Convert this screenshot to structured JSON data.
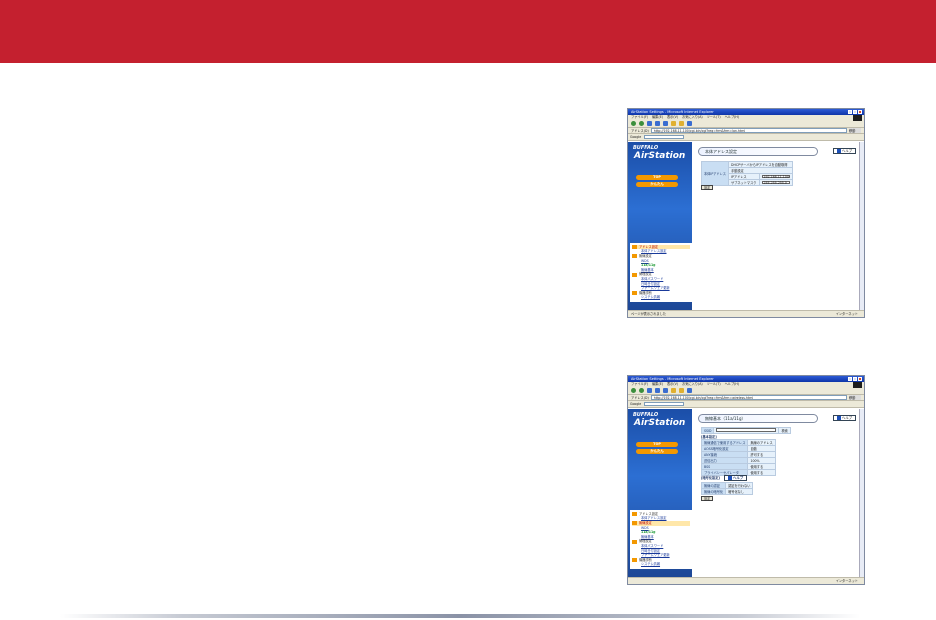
{
  "theme": {
    "banner_color": "#c4202f",
    "accent_orange": "#f39800",
    "sidebar_blue": "#1b4ea8"
  },
  "shot1": {
    "window_title": "AirStation Settings - Microsoft Internet Explorer",
    "menu": [
      "ファイル(F)",
      "編集(E)",
      "表示(V)",
      "お気に入り(A)",
      "ツール(T)",
      "ヘルプ(H)"
    ],
    "address_label": "アドレス(D)",
    "address": "http://192.168.11.100/cgi-bin/cgi?req=frm&frm=lan.html",
    "go_label": "移動",
    "google_label": "Google",
    "brand": "BUFFALO",
    "product": "AirStation",
    "nav_top": "TOP",
    "nav_advanced": "かんたん",
    "menu_items": [
      "アドレス設定",
      "本体アドレス設定",
      "無線設定",
      "WDS",
      "11a/11g",
      "無線基本",
      "管理設定",
      "本体パスワード",
      "日時日付設定",
      "ファームウェア更新",
      "機器診断",
      "システム情報"
    ],
    "page_title": "本体アドレス設定",
    "help": "ヘルプ",
    "field_label": "本体IPアドレス",
    "option1": "DHCPサーバからIPアドレスを自動取得",
    "option2": "手動設定",
    "ip_label": "IPアドレス",
    "ip_value": "192.168.11.100",
    "mask_label": "サブネットマスク",
    "mask_value": "255.255.255.0",
    "submit": "設定",
    "status_left": "ページが表示されました",
    "status_right": "インターネット"
  },
  "shot2": {
    "window_title": "AirStation Settings - Microsoft Internet Explorer",
    "menu": [
      "ファイル(F)",
      "編集(E)",
      "表示(V)",
      "お気に入り(A)",
      "ツール(T)",
      "ヘルプ(H)"
    ],
    "address_label": "アドレス(D)",
    "address": "http://192.168.11.100/cgi-bin/cgi?req=frm&frm=wireless.html",
    "go_label": "移動",
    "google_label": "Google",
    "brand": "BUFFALO",
    "product": "AirStation",
    "nav_top": "TOP",
    "nav_advanced": "かんたん",
    "menu_items": [
      "アドレス設定",
      "本体アドレス設定",
      "無線設定",
      "WDS",
      "11a/11g",
      "無線基本",
      "管理設定",
      "本体パスワード",
      "日時日付設定",
      "ファームウェア更新",
      "機器診断",
      "システム情報"
    ],
    "page_title": "無線基本（11a/11g）",
    "help": "ヘルプ",
    "ssid_label": "SSID",
    "ssid_btn": "検索",
    "basic_section": "[基本設定]",
    "rows": [
      {
        "label": "無線通信で使用するアドレス",
        "value": "無線のアドレス"
      },
      {
        "label": "AOSS暗号化設定",
        "value": "自動"
      },
      {
        "label": "ANY接続",
        "value": "許可する"
      },
      {
        "label": "送信出力",
        "value": "100%"
      },
      {
        "label": "BSS",
        "value": "使用する"
      },
      {
        "label": "プライバシーセパレータ",
        "value": "使用する"
      }
    ],
    "security_section": "[暗号化設定]",
    "security_help": "ヘルプ",
    "sec_rows": [
      {
        "label": "無線の認証",
        "value": "認証を行わない"
      },
      {
        "label": "無線の暗号化",
        "value": "暗号化なし"
      }
    ],
    "submit": "設定",
    "status_left": "",
    "status_right": "インターネット"
  }
}
